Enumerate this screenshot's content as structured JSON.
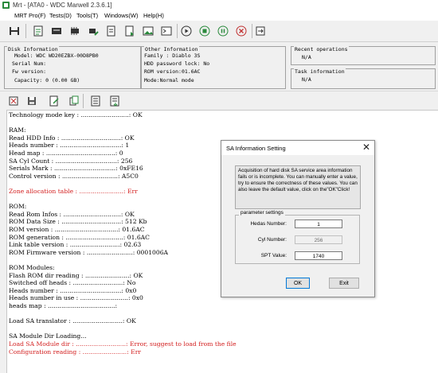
{
  "window": {
    "title": "Mrt - [ATA0 - WDC Marwell 2.3.6.1]"
  },
  "menu": [
    "MRT Pro(F)",
    "Tests(D)",
    "Tools(T)",
    "Windows(W)",
    "Help(H)"
  ],
  "toolbar": {
    "icons": [
      "connect-icon",
      "report-icon",
      "hdd-icon",
      "chip-icon",
      "chip-icon",
      "script-icon",
      "script-icon",
      "image-icon",
      "terminal-icon",
      "play-icon",
      "stop-icon",
      "pause-icon",
      "cancel-icon",
      "exit-icon"
    ]
  },
  "disk_info": {
    "header": "Disk Information",
    "model": "Model: WDC WD20EZBX-00D8PB0",
    "serial": "Serial Num:",
    "fw": "Fw version:",
    "capacity": "Capacity: 0 (0.00 GB)"
  },
  "other_info": {
    "header": "Other Information",
    "family": "Family  : Diablo 3S",
    "pwd_lock": "HDD password lock: No",
    "rom_version": "ROM version:01.6AC",
    "mode": "Mode:Normal mode"
  },
  "recent_ops": {
    "header": "Recent operations",
    "value": "N/A"
  },
  "task_info": {
    "header": "Task information",
    "value": "N/A"
  },
  "log": [
    {
      "text": "Technology mode key : .........................: OK",
      "color": "normal"
    },
    {
      "text": "",
      "color": "normal"
    },
    {
      "text": "RAM:",
      "color": "normal"
    },
    {
      "text": "Read HDD Info : ...............................: OK",
      "color": "normal"
    },
    {
      "text": "Heads number : ................................: 1",
      "color": "normal"
    },
    {
      "text": "Head map : ....................................: 0",
      "color": "normal"
    },
    {
      "text": "SA Cyl Count : ................................: 256",
      "color": "normal"
    },
    {
      "text": "Serials Mark : ................................: 0xFE16",
      "color": "normal"
    },
    {
      "text": "Control version : .............................: A5C0",
      "color": "normal"
    },
    {
      "text": "",
      "color": "normal"
    },
    {
      "text": "Zone allocation table : .......................: Err",
      "color": "red"
    },
    {
      "text": "",
      "color": "normal"
    },
    {
      "text": "ROM:",
      "color": "normal"
    },
    {
      "text": "Read Rom Infos : ..............................: OK",
      "color": "normal"
    },
    {
      "text": "ROM Data Size : ...............................: 512 Kb",
      "color": "normal"
    },
    {
      "text": "ROM version : .................................: 01.6AC",
      "color": "normal"
    },
    {
      "text": "ROM generation : ..............................: 01.6AC",
      "color": "normal"
    },
    {
      "text": "Link table version : ..........................: 02.63",
      "color": "normal"
    },
    {
      "text": "ROM Firmware version : ........................: 0001006A",
      "color": "normal"
    },
    {
      "text": "",
      "color": "normal"
    },
    {
      "text": "ROM Modules:",
      "color": "normal"
    },
    {
      "text": "Flash ROM dir reading : .......................: OK",
      "color": "normal"
    },
    {
      "text": "Switched off heads : ..........................: No",
      "color": "normal"
    },
    {
      "text": "Heads number : ................................: 0x0",
      "color": "normal"
    },
    {
      "text": "Heads number in use : .........................: 0x0",
      "color": "normal"
    },
    {
      "text": "heads map : ...................................:",
      "color": "normal"
    },
    {
      "text": "",
      "color": "normal"
    },
    {
      "text": "Load SA translator : ..........................: OK",
      "color": "normal"
    },
    {
      "text": "",
      "color": "normal"
    },
    {
      "text": "SA Module Dir Loading...",
      "color": "normal"
    },
    {
      "text": "Load SA Module dir : ..........................: Error, suggest to load from the file",
      "color": "red"
    },
    {
      "text": "Configuration reading : .......................: Err",
      "color": "red"
    }
  ],
  "dialog": {
    "title": "SA Information Setting",
    "description": "Acquisition of hard disk SA service area information fails or is incomplete. You can manually enter a value, try to ensure the correctness of these values. You can also leave the default value, click on the\"OK\"Click!",
    "group_label": "parameter settings",
    "heads_label": "Hedas Number:",
    "heads_value": "1",
    "cyl_label": "Cyl Number:",
    "cyl_value": "256",
    "spt_label": "SPT Value:",
    "spt_value": "1740",
    "ok_label": "OK",
    "exit_label": "Exit"
  },
  "colors": {
    "error_text": "#d32020",
    "title_bar": "#ffffff",
    "app_icon": "#2a8a3c"
  }
}
